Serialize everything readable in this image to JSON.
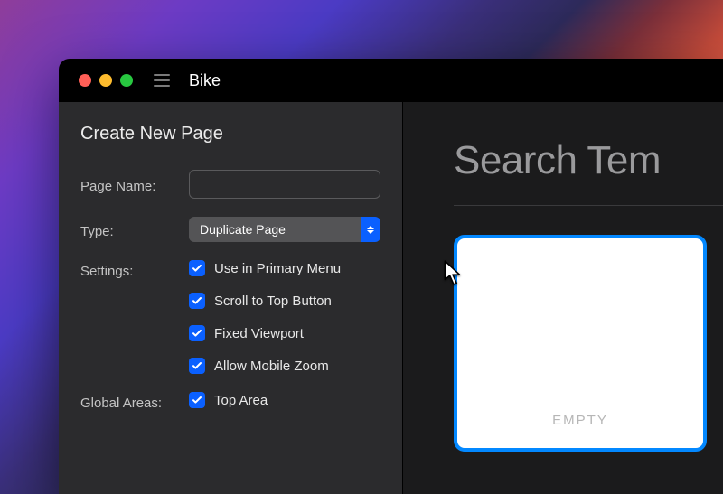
{
  "app": {
    "title": "Bike"
  },
  "sidebar": {
    "sectionTitle": "Create New Page",
    "pageNameLabel": "Page Name:",
    "pageNameValue": "",
    "typeLabel": "Type:",
    "typeValue": "Duplicate Page",
    "settingsLabel": "Settings:",
    "settings": [
      {
        "label": "Use in Primary Menu",
        "checked": true
      },
      {
        "label": "Scroll to Top Button",
        "checked": true
      },
      {
        "label": "Fixed Viewport",
        "checked": true
      },
      {
        "label": "Allow Mobile Zoom",
        "checked": true
      }
    ],
    "globalAreasLabel": "Global Areas:",
    "globalAreas": [
      {
        "label": "Top Area",
        "checked": true
      }
    ]
  },
  "main": {
    "heading": "Search Tem",
    "templateLabel": "EMPTY"
  }
}
